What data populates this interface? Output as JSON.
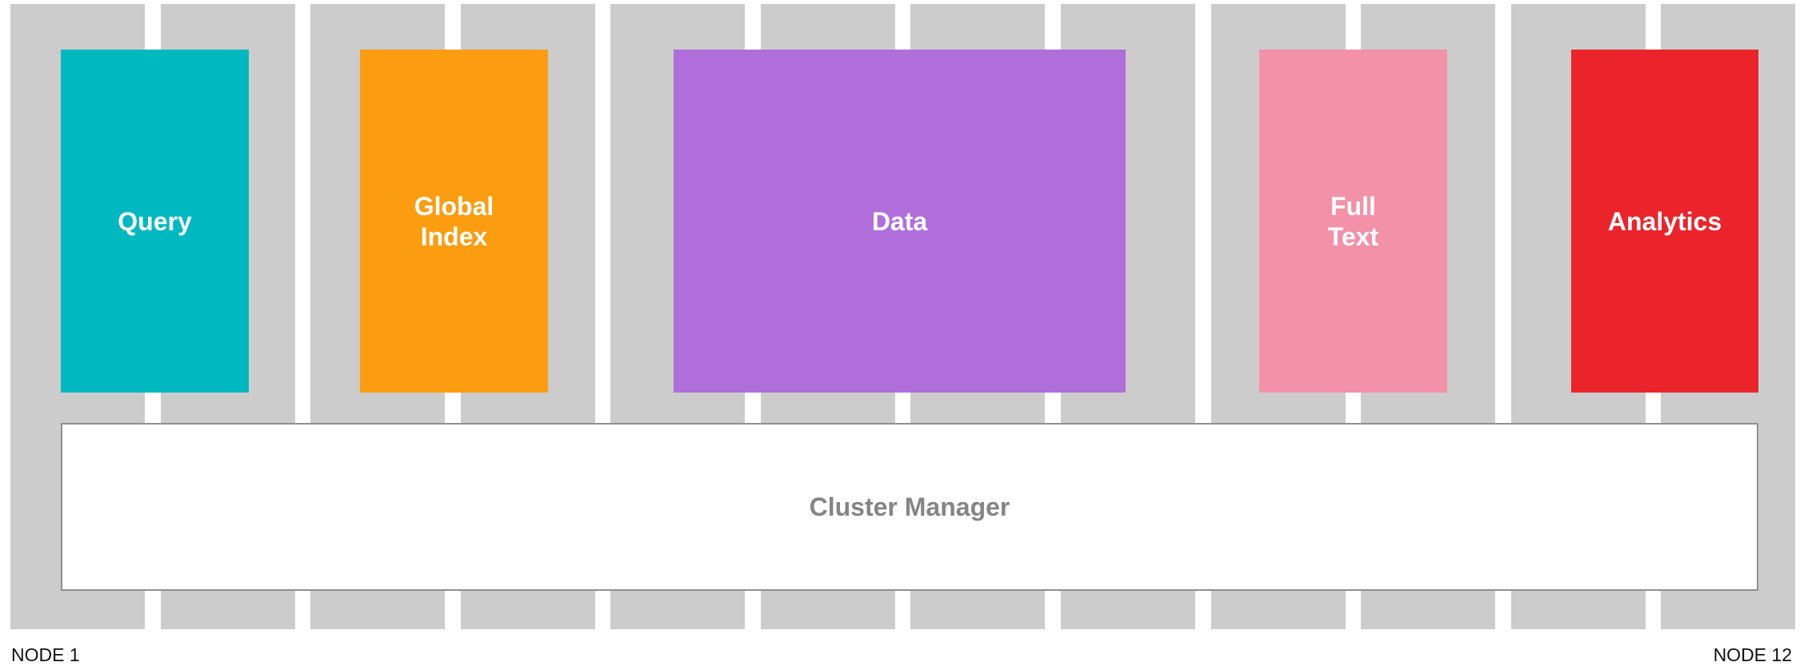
{
  "nodes": [
    {
      "id": 1
    },
    {
      "id": 2
    },
    {
      "id": 3
    },
    {
      "id": 4
    },
    {
      "id": 5
    },
    {
      "id": 6
    },
    {
      "id": 7
    },
    {
      "id": 8
    },
    {
      "id": 9
    },
    {
      "id": 10
    },
    {
      "id": 11
    },
    {
      "id": 12
    }
  ],
  "services": [
    {
      "key": "query",
      "label": "Query",
      "color": "#00b8bf"
    },
    {
      "key": "global-index",
      "label": "Global\nIndex",
      "color": "#fc9c10"
    },
    {
      "key": "data",
      "label": "Data",
      "color": "#b06edb"
    },
    {
      "key": "full-text",
      "label": "Full\nText",
      "color": "#f391a9"
    },
    {
      "key": "analytics",
      "label": "Analytics",
      "color": "#eb242b"
    }
  ],
  "cluster_manager": {
    "label": "Cluster Manager"
  },
  "labels": {
    "first_node": "NODE 1",
    "last_node": "NODE 12"
  },
  "colors": {
    "node_background": "#cccccc",
    "cluster_manager_border": "#909090",
    "cluster_manager_text": "#858585"
  }
}
